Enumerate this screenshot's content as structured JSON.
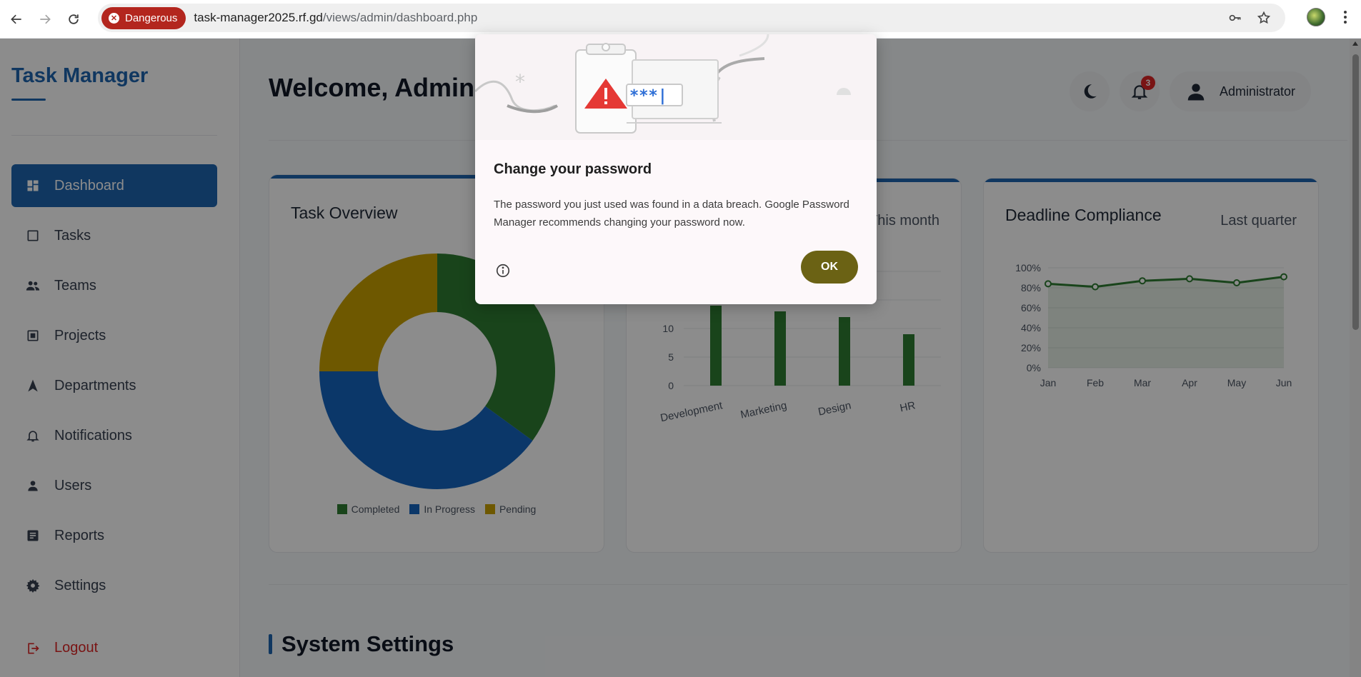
{
  "browser": {
    "security_label": "Dangerous",
    "url_host": "task-manager2025.rf.gd",
    "url_path": "/views/admin/dashboard.php"
  },
  "sidebar": {
    "brand": "Task Manager",
    "items": [
      {
        "label": "Dashboard",
        "icon": "dashboard-icon",
        "active": true
      },
      {
        "label": "Tasks",
        "icon": "checkbox-icon"
      },
      {
        "label": "Teams",
        "icon": "users-group-icon"
      },
      {
        "label": "Projects",
        "icon": "project-icon"
      },
      {
        "label": "Departments",
        "icon": "arrow-icon"
      },
      {
        "label": "Notifications",
        "icon": "bell-icon"
      },
      {
        "label": "Users",
        "icon": "user-icon"
      },
      {
        "label": "Reports",
        "icon": "report-icon"
      },
      {
        "label": "Settings",
        "icon": "gear-icon"
      }
    ],
    "logout": "Logout"
  },
  "header": {
    "welcome": "Welcome, Administrator",
    "notif_count": "3",
    "user_name": "Administrator"
  },
  "cards": {
    "task_overview": {
      "title": "Task Overview"
    },
    "dept": {
      "subtitle": "This month"
    },
    "deadline": {
      "title": "Deadline Compliance",
      "subtitle": "Last quarter"
    }
  },
  "section": {
    "title": "System Settings"
  },
  "colors": {
    "primary": "#1e64b0",
    "green": "#2e7d32",
    "gold": "#c8a000",
    "danger": "#b3261e",
    "ok": "#6b6214"
  },
  "chart_data": [
    {
      "type": "pie",
      "title": "Task Overview",
      "categories": [
        "Completed",
        "In Progress",
        "Pending"
      ],
      "values": [
        35,
        40,
        25
      ],
      "colors": [
        "#2e7d32",
        "#1565c0",
        "#c8a000"
      ]
    },
    {
      "type": "bar",
      "categories": [
        "Development",
        "Marketing",
        "Design",
        "HR"
      ],
      "values": [
        14,
        13,
        12,
        9
      ],
      "yticks": [
        0,
        5,
        10
      ],
      "ylim": [
        0,
        20
      ]
    },
    {
      "type": "line",
      "title": "Deadline Compliance",
      "categories": [
        "Jan",
        "Feb",
        "Mar",
        "Apr",
        "May",
        "Jun"
      ],
      "values": [
        84,
        81,
        87,
        89,
        85,
        91
      ],
      "ylim": [
        0,
        100
      ],
      "yticks": [
        "0%",
        "20%",
        "40%",
        "60%",
        "80%",
        "100%"
      ]
    }
  ],
  "dialog": {
    "title": "Change your password",
    "body": "The password you just used was found in a data breach. Google Password Manager recommends changing your password now.",
    "ok": "OK",
    "art_mask": "***|"
  }
}
